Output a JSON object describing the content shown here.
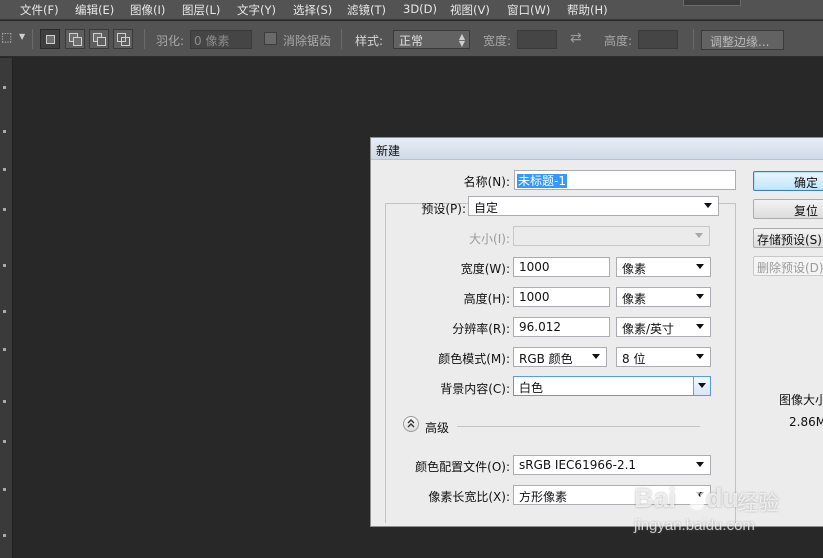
{
  "menubar": {
    "items": [
      "文件(F)",
      "编辑(E)",
      "图像(I)",
      "图层(L)",
      "文字(Y)",
      "选择(S)",
      "滤镜(T)",
      "3D(D)",
      "视图(V)",
      "窗口(W)",
      "帮助(H)"
    ]
  },
  "options": {
    "feather_label": "羽化:",
    "feather_value": "0 像素",
    "antialias_label": "消除锯齿",
    "style_label": "样式:",
    "style_value": "正常",
    "width_label": "宽度:",
    "height_label": "高度:",
    "refine_edge_button": "调整边缘..."
  },
  "dialog": {
    "title": "新建",
    "name_label": "名称(N):",
    "name_value": "未标题-1",
    "preset_label": "预设(P):",
    "preset_value": "自定",
    "size_label": "大小(I):",
    "width_label": "宽度(W):",
    "width_value": "1000",
    "width_unit": "像素",
    "height_label": "高度(H):",
    "height_value": "1000",
    "height_unit": "像素",
    "resolution_label": "分辨率(R):",
    "resolution_value": "96.012",
    "resolution_unit": "像素/英寸",
    "color_mode_label": "颜色模式(M):",
    "color_mode_value": "RGB 颜色",
    "bit_depth_value": "8 位",
    "background_label": "背景内容(C):",
    "background_value": "白色",
    "advanced_label": "高级",
    "color_profile_label": "颜色配置文件(O):",
    "color_profile_value": "sRGB IEC61966-2.1",
    "pixel_aspect_label": "像素长宽比(X):",
    "pixel_aspect_value": "方形像素",
    "ok_button": "确定",
    "reset_button": "复位",
    "save_preset_button": "存储预设(S)...",
    "delete_preset_button": "删除预设(D)...",
    "image_size_label": "图像大小:",
    "image_size_value": "2.86M"
  },
  "watermark": {
    "brand": "Bai",
    "brand2": "du",
    "site_cn": "经验",
    "url": "jingyan.baidu.com"
  },
  "colors": {
    "app_bg": "#282828",
    "bar_bg": "#535353",
    "dialog_bg": "#ececec",
    "selection": "#3399ff"
  }
}
